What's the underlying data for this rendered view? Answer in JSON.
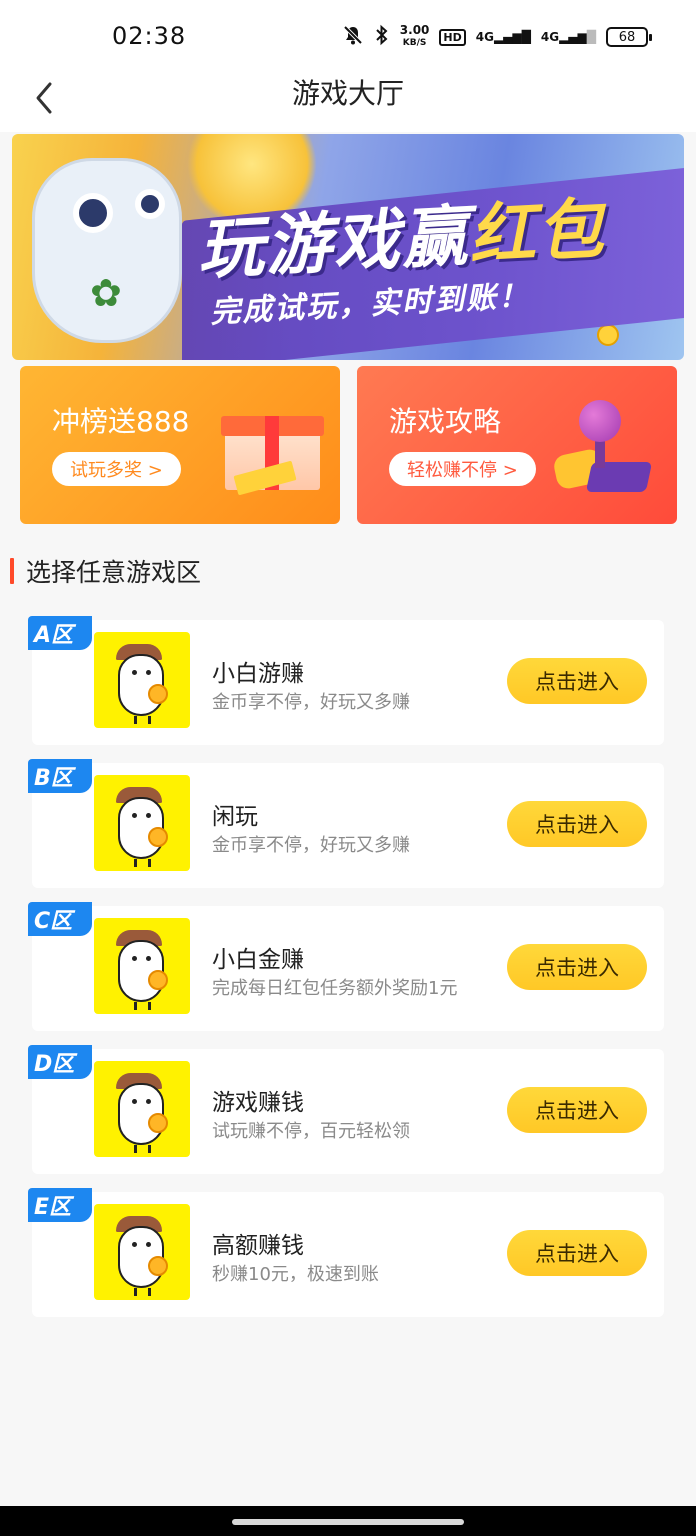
{
  "status_bar": {
    "time": "02:38",
    "speed_value": "3.00",
    "speed_unit": "KB/S",
    "hd_label": "HD",
    "signal1": "4G",
    "signal2": "4G",
    "battery": "68"
  },
  "header": {
    "title": "游戏大厅"
  },
  "banner": {
    "headline_main": "玩游戏赢",
    "headline_highlight": "红包",
    "subline": "完成试玩，实时到账！"
  },
  "promos": [
    {
      "title": "冲榜送888",
      "button": "试玩多奖 >"
    },
    {
      "title": "游戏攻略",
      "button": "轻松赚不停 >"
    }
  ],
  "section": {
    "title": "选择任意游戏区"
  },
  "zones": [
    {
      "tag": "A区",
      "name": "小白游赚",
      "desc": "金币享不停，好玩又多赚",
      "button": "点击进入"
    },
    {
      "tag": "B区",
      "name": "闲玩",
      "desc": "金币享不停，好玩又多赚",
      "button": "点击进入"
    },
    {
      "tag": "C区",
      "name": "小白金赚",
      "desc": "完成每日红包任务额外奖励1元",
      "button": "点击进入"
    },
    {
      "tag": "D区",
      "name": "游戏赚钱",
      "desc": "试玩赚不停，百元轻松领",
      "button": "点击进入"
    },
    {
      "tag": "E区",
      "name": "高额赚钱",
      "desc": "秒赚10元，极速到账",
      "button": "点击进入"
    }
  ],
  "colors": {
    "accent_yellow": "#ffc826",
    "tag_blue": "#1d87f0",
    "section_bar": "#ff4a2a",
    "promo_orange": "#ff8c1a",
    "promo_red": "#ff4b3a"
  }
}
